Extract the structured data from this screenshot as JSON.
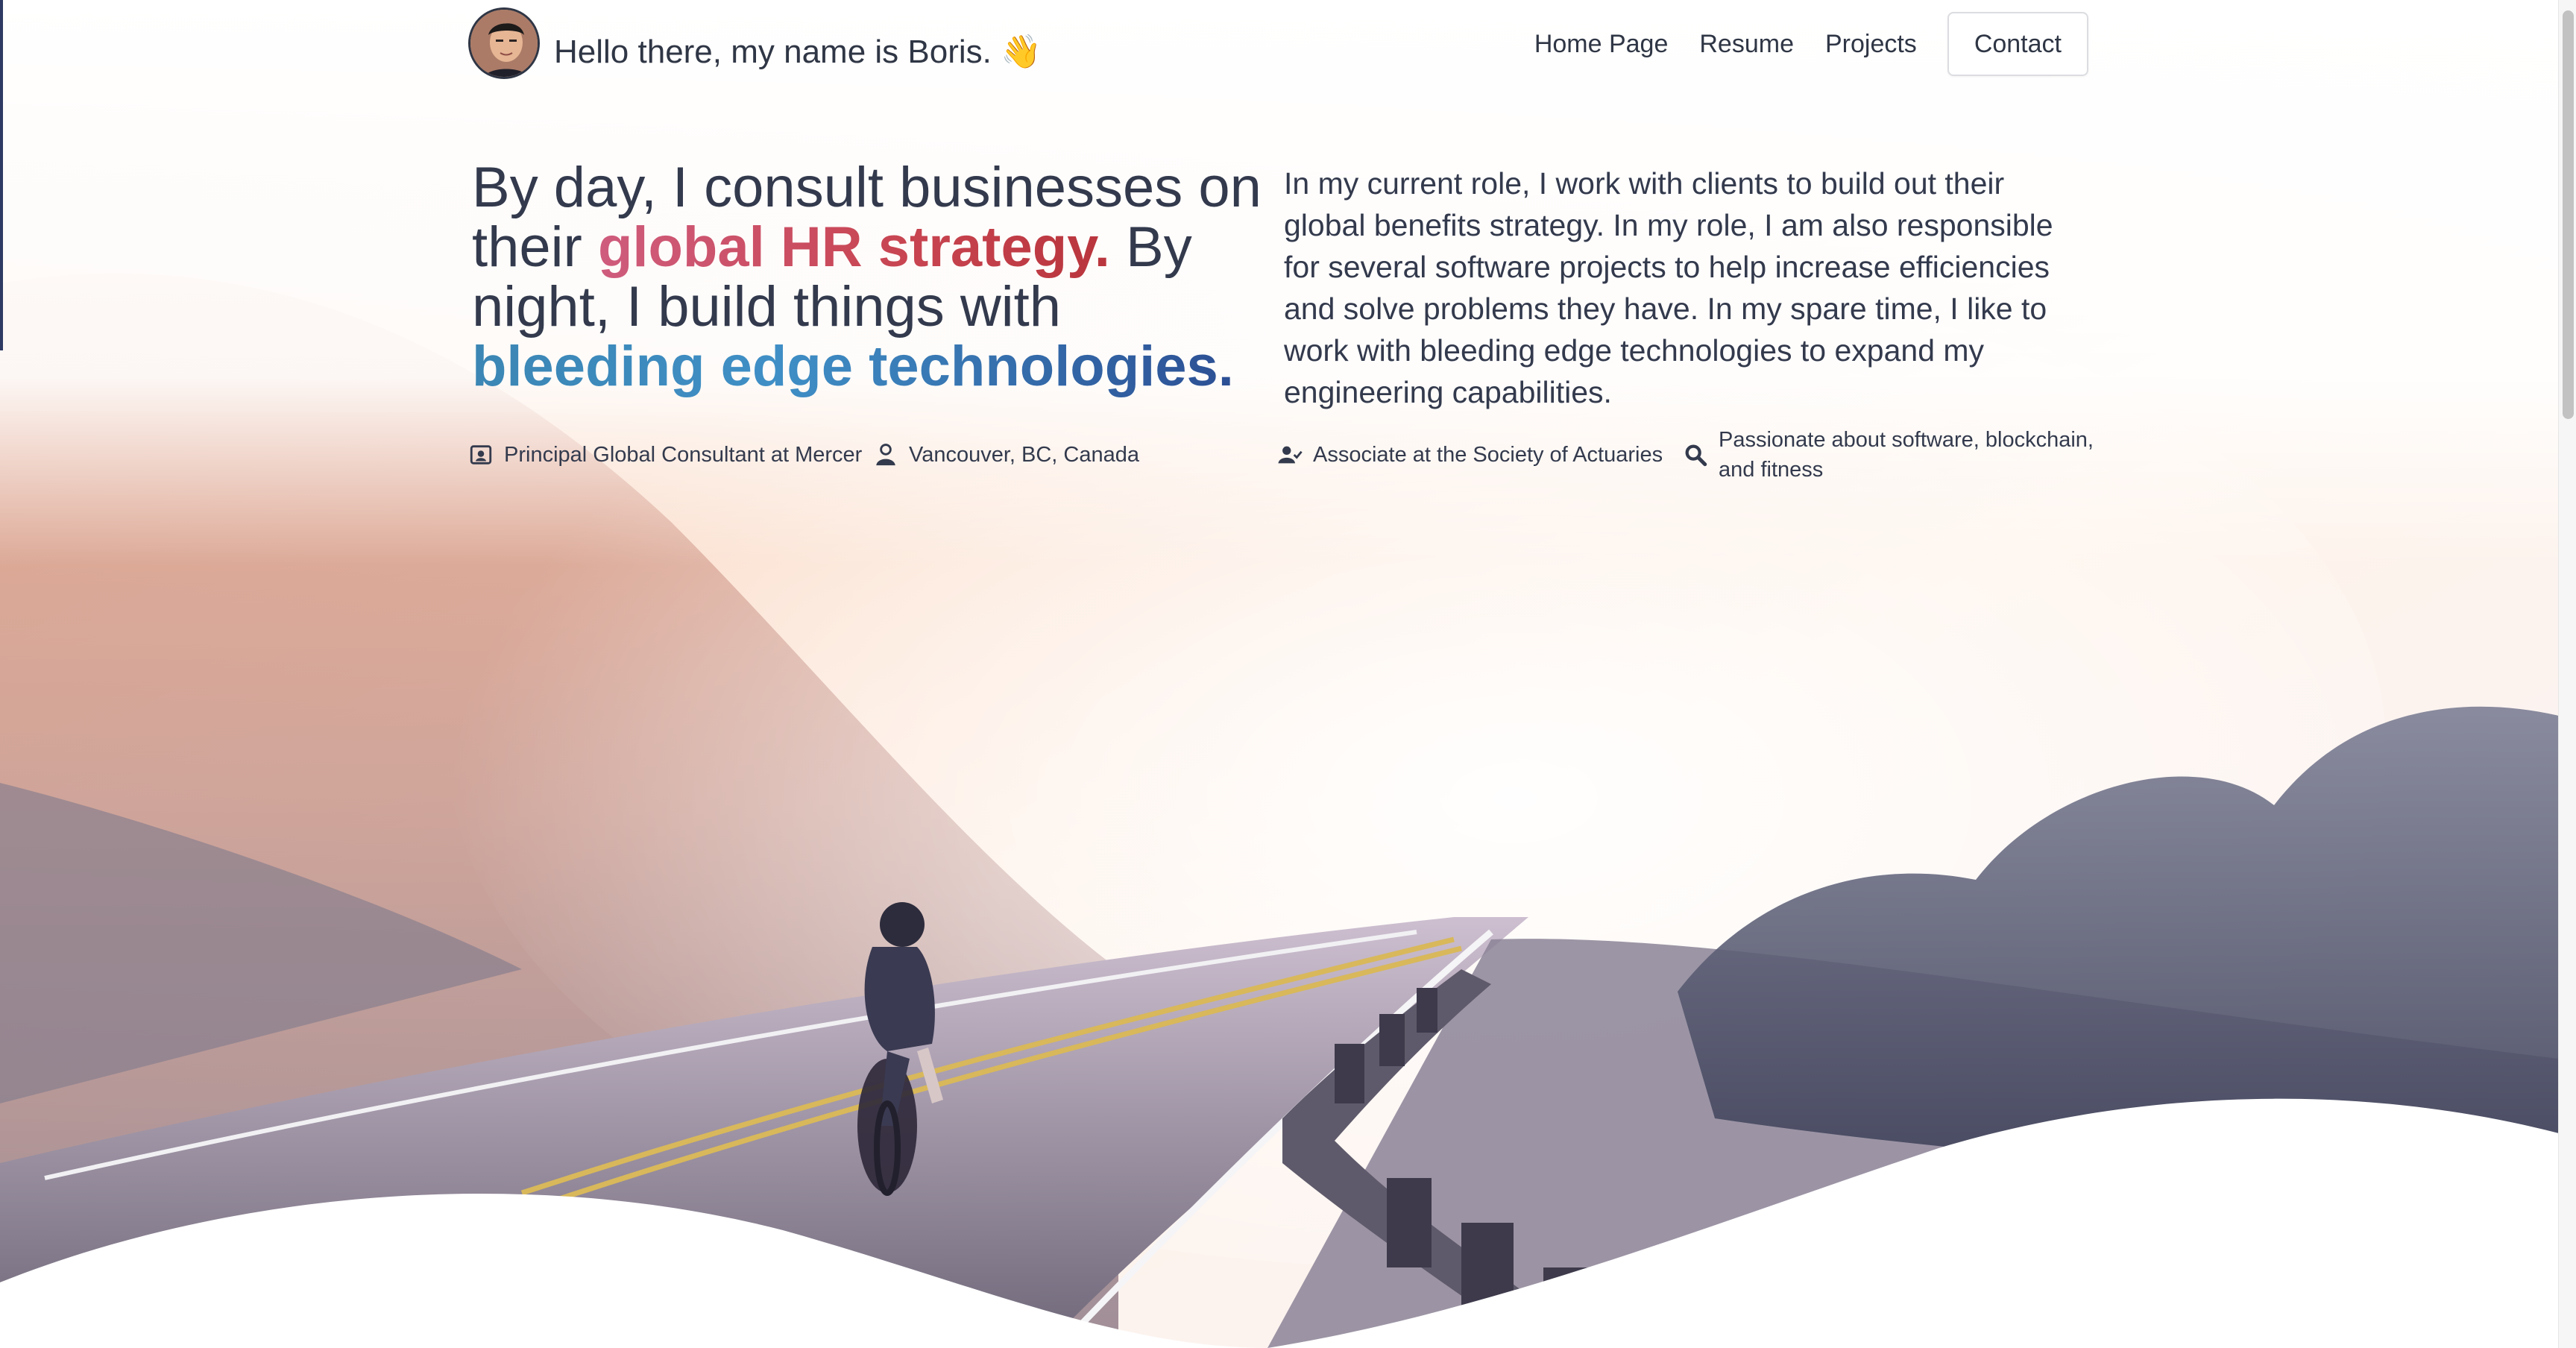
{
  "header": {
    "greeting": "Hello there, my name is Boris. 👋"
  },
  "nav": {
    "items": [
      {
        "label": "Home Page"
      },
      {
        "label": "Resume"
      },
      {
        "label": "Projects"
      }
    ],
    "contact_label": "Contact"
  },
  "hero": {
    "headline": {
      "part1": "By day, I consult businesses on their ",
      "highlight1": "global HR strategy.",
      "part2": " By night, I build things with ",
      "highlight2": "bleeding edge technologies."
    },
    "intro": "In my current role, I work with clients to build out their global benefits strategy. In my role, I am also responsible for several software projects to help increase efficiencies and solve problems they have. In my spare time, I like to work with bleeding edge technologies to expand my engineering capabilities."
  },
  "facts": [
    {
      "icon": "id-badge-icon",
      "text": "Principal Global Consultant at Mercer"
    },
    {
      "icon": "person-icon",
      "text": "Vancouver, BC, Canada"
    },
    {
      "icon": "user-check-icon",
      "text": "Associate at the Society of Actuaries"
    },
    {
      "icon": "search-icon",
      "text": "Passionate about software, blockchain, and fitness"
    }
  ],
  "colors": {
    "text": "#333a4d",
    "accent_red": "#c84551",
    "accent_blue": "#3f8fc6"
  }
}
